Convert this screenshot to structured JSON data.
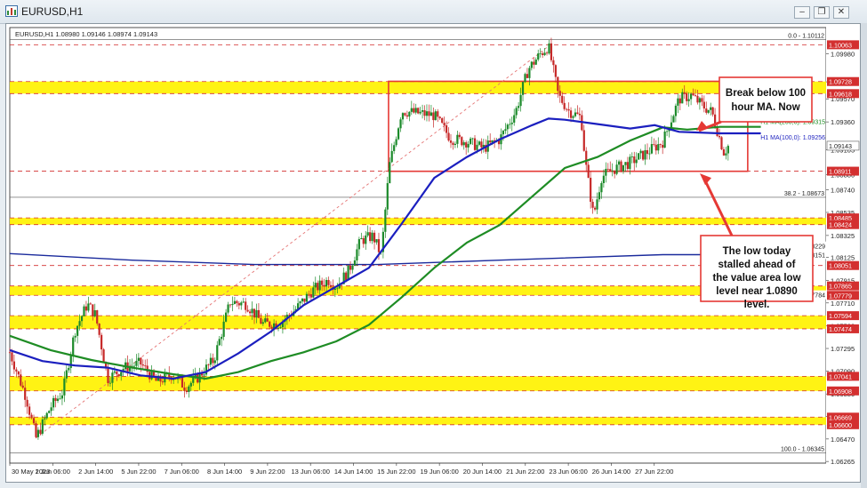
{
  "window": {
    "title": "EURUSD,H1",
    "buttons": {
      "minimize": "–",
      "restore": "❐",
      "close": "✕"
    }
  },
  "chart_data": {
    "type": "candlestick",
    "symbol_header": "EURUSD,H1  1.08980 1.09146 1.08974 1.09143",
    "ylim": [
      1.0625,
      1.1022
    ],
    "price_labels": [
      "1.09980",
      "1.09725",
      "1.09570",
      "1.09360",
      "1.09105",
      "1.08880",
      "1.08740",
      "1.08535",
      "1.08325",
      "1.08125",
      "1.07915",
      "1.07710",
      "1.07500",
      "1.07295",
      "1.07090",
      "1.06880",
      "1.06675",
      "1.06470",
      "1.06265"
    ],
    "price_values": [
      1.0998,
      1.09725,
      1.0957,
      1.0936,
      1.09105,
      1.0888,
      1.0874,
      1.08535,
      1.08325,
      1.08125,
      1.07915,
      1.0771,
      1.075,
      1.07295,
      1.0709,
      1.0688,
      1.06675,
      1.0647,
      1.06265
    ],
    "time_labels": [
      "30 May 2023",
      "1 Jun 06:00",
      "2 Jun 14:00",
      "5 Jun 22:00",
      "7 Jun 06:00",
      "8 Jun 14:00",
      "9 Jun 22:00",
      "13 Jun 06:00",
      "14 Jun 14:00",
      "15 Jun 22:00",
      "19 Jun 06:00",
      "20 Jun 14:00",
      "21 Jun 22:00",
      "23 Jun 06:00",
      "26 Jun 14:00",
      "27 Jun 22:00"
    ],
    "time_positions": [
      0.0,
      0.0526,
      0.1053,
      0.1579,
      0.2105,
      0.2632,
      0.3158,
      0.3684,
      0.4211,
      0.4737,
      0.5263,
      0.5789,
      0.6316,
      0.6842,
      0.7368,
      0.7895
    ],
    "levels": [
      {
        "label": "1.10063",
        "value": 1.10063,
        "style": "dashed-red"
      },
      {
        "label": "1.09728",
        "value": 1.09728,
        "style": "dashed-red"
      },
      {
        "label": "1.09618",
        "value": 1.09618,
        "style": "dashed-red"
      },
      {
        "label": "1.08911",
        "value": 1.08911,
        "style": "dashed-red"
      },
      {
        "label": "1.08485",
        "value": 1.08485,
        "style": "dashed-red"
      },
      {
        "label": "1.08424",
        "value": 1.08424,
        "style": "dashed-red"
      },
      {
        "label": "1.08051",
        "value": 1.08051,
        "style": "dashed-red"
      },
      {
        "label": "1.07865",
        "value": 1.07865,
        "style": "dashed-red"
      },
      {
        "label": "1.07779",
        "value": 1.07779,
        "style": "dashed-red"
      },
      {
        "label": "1.07594",
        "value": 1.07594,
        "style": "dashed-red"
      },
      {
        "label": "1.07474",
        "value": 1.07474,
        "style": "dashed-red"
      },
      {
        "label": "1.07041",
        "value": 1.07041,
        "style": "dashed-red"
      },
      {
        "label": "1.06908",
        "value": 1.06908,
        "style": "dashed-red"
      },
      {
        "label": "1.06669",
        "value": 1.06669,
        "style": "dashed-red"
      },
      {
        "label": "1.06600",
        "value": 1.066,
        "style": "dashed-red"
      }
    ],
    "fib_levels": [
      {
        "label": "0.0 - 1.10112",
        "value": 1.10112
      },
      {
        "label": "38.2 - 1.08673",
        "value": 1.08673
      },
      {
        "label": "100.0 - 1.06345",
        "value": 1.06345
      }
    ],
    "extra_price_tags": [
      {
        "label": "1.08229",
        "value": 1.08229
      },
      {
        "label": "1.08151",
        "value": 1.08151
      },
      {
        "label": "1.07784",
        "value": 1.07784
      }
    ],
    "current_price": {
      "label": "1.09143",
      "value": 1.09143
    },
    "yellow_bands": [
      [
        1.09618,
        1.09728
      ],
      [
        1.08424,
        1.08485
      ],
      [
        1.07779,
        1.07865
      ],
      [
        1.07474,
        1.07594
      ],
      [
        1.06908,
        1.07041
      ],
      [
        1.066,
        1.06669
      ]
    ],
    "ma_labels": {
      "ma200": "H1 MA(200,0): 1.09315",
      "ma100": "H1 MA(100,0): 1.09256"
    },
    "ma200": [
      [
        0.0,
        1.0741
      ],
      [
        0.05,
        1.0728
      ],
      [
        0.1,
        1.0719
      ],
      [
        0.15,
        1.0712
      ],
      [
        0.2,
        1.0706
      ],
      [
        0.24,
        1.0702
      ],
      [
        0.28,
        1.0708
      ],
      [
        0.32,
        1.0718
      ],
      [
        0.36,
        1.0726
      ],
      [
        0.4,
        1.0736
      ],
      [
        0.44,
        1.0751
      ],
      [
        0.48,
        1.0776
      ],
      [
        0.52,
        1.0803
      ],
      [
        0.56,
        1.0826
      ],
      [
        0.6,
        1.0842
      ],
      [
        0.64,
        1.0868
      ],
      [
        0.68,
        1.0894
      ],
      [
        0.72,
        1.0904
      ],
      [
        0.76,
        1.0919
      ],
      [
        0.8,
        1.0931
      ],
      [
        0.83,
        1.0929
      ],
      [
        0.87,
        1.09315
      ],
      [
        0.92,
        1.09315
      ]
    ],
    "ma100": [
      [
        0.0,
        1.0728
      ],
      [
        0.04,
        1.0718
      ],
      [
        0.08,
        1.0714
      ],
      [
        0.12,
        1.0712
      ],
      [
        0.16,
        1.0705
      ],
      [
        0.2,
        1.0702
      ],
      [
        0.24,
        1.0708
      ],
      [
        0.28,
        1.0725
      ],
      [
        0.32,
        1.0745
      ],
      [
        0.36,
        1.0769
      ],
      [
        0.4,
        1.0786
      ],
      [
        0.44,
        1.0803
      ],
      [
        0.48,
        1.0843
      ],
      [
        0.52,
        1.0885
      ],
      [
        0.56,
        1.0904
      ],
      [
        0.6,
        1.092
      ],
      [
        0.64,
        1.0933
      ],
      [
        0.66,
        1.0939
      ],
      [
        0.68,
        1.0938
      ],
      [
        0.72,
        1.0934
      ],
      [
        0.76,
        1.093
      ],
      [
        0.79,
        1.0933
      ],
      [
        0.82,
        1.0927
      ],
      [
        0.87,
        1.09256
      ],
      [
        0.92,
        1.09256
      ]
    ],
    "blue_line": [
      [
        0.0,
        1.0816
      ],
      [
        0.15,
        1.081
      ],
      [
        0.3,
        1.0806
      ],
      [
        0.45,
        1.0806
      ],
      [
        0.6,
        1.081
      ],
      [
        0.8,
        1.0815
      ],
      [
        0.86,
        1.0815
      ]
    ],
    "price_path": [
      [
        0.0,
        1.0726
      ],
      [
        0.02,
        1.0685
      ],
      [
        0.032,
        1.0648
      ],
      [
        0.05,
        1.0676
      ],
      [
        0.065,
        1.069
      ],
      [
        0.08,
        1.0746
      ],
      [
        0.095,
        1.077
      ],
      [
        0.105,
        1.076
      ],
      [
        0.12,
        1.0702
      ],
      [
        0.14,
        1.0712
      ],
      [
        0.16,
        1.0716
      ],
      [
        0.18,
        1.0699
      ],
      [
        0.2,
        1.0706
      ],
      [
        0.215,
        1.0694
      ],
      [
        0.23,
        1.0703
      ],
      [
        0.25,
        1.0719
      ],
      [
        0.27,
        1.0772
      ],
      [
        0.29,
        1.077
      ],
      [
        0.31,
        1.0752
      ],
      [
        0.33,
        1.0752
      ],
      [
        0.35,
        1.0765
      ],
      [
        0.37,
        1.0782
      ],
      [
        0.39,
        1.0792
      ],
      [
        0.4,
        1.0786
      ],
      [
        0.415,
        1.08
      ],
      [
        0.43,
        1.0828
      ],
      [
        0.445,
        1.0832
      ],
      [
        0.455,
        1.0814
      ],
      [
        0.465,
        1.0896
      ],
      [
        0.48,
        1.0946
      ],
      [
        0.5,
        1.0944
      ],
      [
        0.52,
        1.0942
      ],
      [
        0.54,
        1.0921
      ],
      [
        0.56,
        1.0918
      ],
      [
        0.58,
        1.0912
      ],
      [
        0.6,
        1.092
      ],
      [
        0.62,
        1.0946
      ],
      [
        0.635,
        1.0984
      ],
      [
        0.65,
        1.0998
      ],
      [
        0.66,
        1.1005
      ],
      [
        0.672,
        1.096
      ],
      [
        0.685,
        1.0946
      ],
      [
        0.7,
        1.094
      ],
      [
        0.705,
        1.09
      ],
      [
        0.715,
        1.085
      ],
      [
        0.725,
        1.0886
      ],
      [
        0.74,
        1.0893
      ],
      [
        0.76,
        1.0899
      ],
      [
        0.78,
        1.0908
      ],
      [
        0.8,
        1.0918
      ],
      [
        0.82,
        1.0957
      ],
      [
        0.835,
        1.096
      ],
      [
        0.85,
        1.095
      ],
      [
        0.86,
        1.0945
      ],
      [
        0.868,
        1.0925
      ],
      [
        0.875,
        1.0908
      ],
      [
        0.88,
        1.0914
      ]
    ],
    "value_area_box": {
      "top": 1.0973,
      "bottom": 1.0891,
      "x0": 0.464,
      "x1": 0.904
    },
    "trendline": [
      [
        0.032,
        1.0648
      ],
      [
        0.66,
        1.1005
      ]
    ],
    "annotations": [
      {
        "id": "break",
        "text": "Break below 100 hour MA. Now"
      },
      {
        "id": "low",
        "text": "The low today stalled ahead of the value area low level near 1.0890 level."
      }
    ]
  }
}
